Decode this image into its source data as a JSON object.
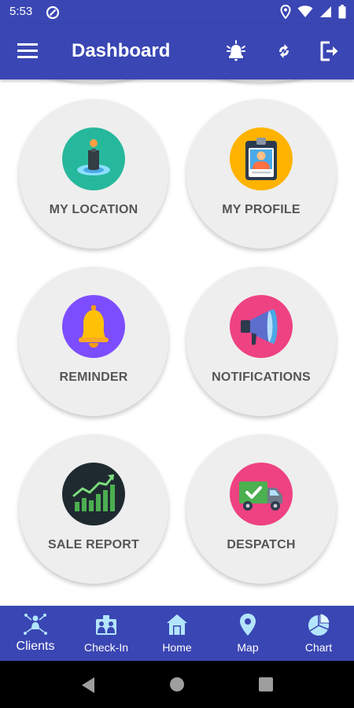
{
  "status_bar": {
    "time": "5:53"
  },
  "app_bar": {
    "title": "Dashboard"
  },
  "tiles": [
    {
      "label": "MY LOCATION",
      "icon": "location-person-icon",
      "color": "#26b89c"
    },
    {
      "label": "MY PROFILE",
      "icon": "id-badge-icon",
      "color": "#ffb300"
    },
    {
      "label": "REMINDER",
      "icon": "bell-icon",
      "color": "#7c4dff"
    },
    {
      "label": "NOTIFICATIONS",
      "icon": "megaphone-icon",
      "color": "#ee4282"
    },
    {
      "label": "SALE REPORT",
      "icon": "bar-chart-icon",
      "color": "#1f2a30"
    },
    {
      "label": "DESPATCH",
      "icon": "delivery-truck-icon",
      "color": "#ee4282"
    }
  ],
  "bottom_nav": [
    {
      "label": "Clients",
      "icon": "clients-icon",
      "active": true
    },
    {
      "label": "Check-In",
      "icon": "check-in-icon"
    },
    {
      "label": "Home",
      "icon": "home-icon"
    },
    {
      "label": "Map",
      "icon": "map-pin-icon"
    },
    {
      "label": "Chart",
      "icon": "pie-chart-icon"
    }
  ],
  "colors": {
    "primary": "#3a46b3",
    "tile_bg": "#eeeeee",
    "tile_text": "#555555"
  }
}
